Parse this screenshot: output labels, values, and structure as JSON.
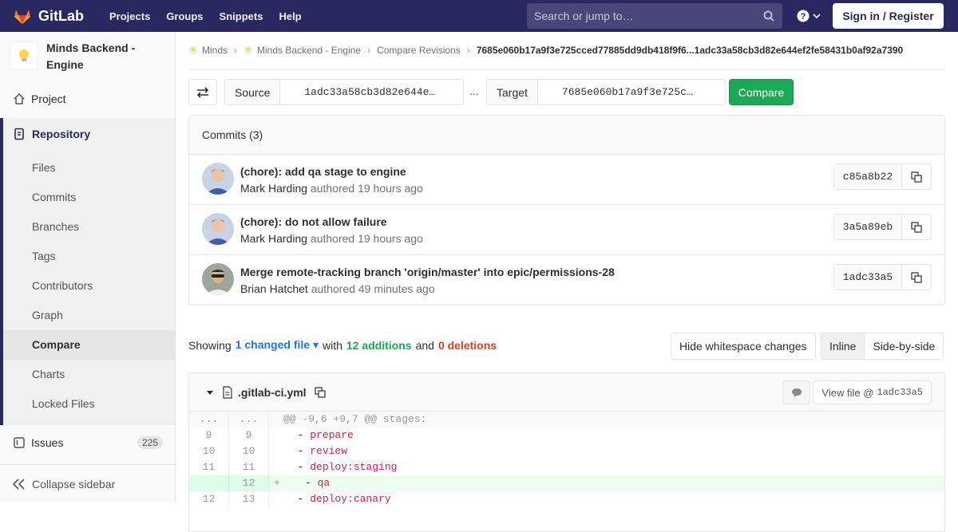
{
  "navbar": {
    "brand": "GitLab",
    "links": [
      "Projects",
      "Groups",
      "Snippets",
      "Help"
    ],
    "search_placeholder": "Search or jump to…",
    "signin_label": "Sign in / Register"
  },
  "sidebar": {
    "project_name": "Minds Backend - Engine",
    "project_link": "Project",
    "repository_label": "Repository",
    "repo_items": [
      "Files",
      "Commits",
      "Branches",
      "Tags",
      "Contributors",
      "Graph",
      "Compare",
      "Charts",
      "Locked Files"
    ],
    "active_item": "Compare",
    "issues_label": "Issues",
    "issues_count": "225",
    "collapse_label": "Collapse sidebar"
  },
  "breadcrumbs": [
    "Minds",
    "Minds Backend - Engine",
    "Compare Revisions",
    "7685e060b17a9f3e725cced77885dd9db418f9f6...1adc33a58cb3d82e644ef2fe58431b0af92a7390"
  ],
  "compare": {
    "source_label": "Source",
    "source_value": "1adc33a58cb3d82e644e…",
    "dots": "...",
    "target_label": "Target",
    "target_value": "7685e060b17a9f3e725c…",
    "compare_button": "Compare"
  },
  "commits": {
    "header": "Commits (3)",
    "items": [
      {
        "title": "(chore): add qa stage to engine",
        "author": "Mark Harding",
        "verb": "authored",
        "time": "19 hours ago",
        "sha": "c85a8b22"
      },
      {
        "title": "(chore): do not allow failure",
        "author": "Mark Harding",
        "verb": "authored",
        "time": "19 hours ago",
        "sha": "3a5a89eb"
      },
      {
        "title": "Merge remote-tracking branch 'origin/master' into epic/permissions-28",
        "author": "Brian Hatchet",
        "verb": "authored",
        "time": "49 minutes ago",
        "sha": "1adc33a5"
      }
    ]
  },
  "summary": {
    "showing": "Showing",
    "changed_files": "1 changed file",
    "with": "with",
    "additions": "12 additions",
    "and": "and",
    "deletions": "0 deletions"
  },
  "diff_controls": {
    "whitespace_button": "Hide whitespace changes",
    "inline_label": "Inline",
    "side_by_side_label": "Side-by-side"
  },
  "file": {
    "name": ".gitlab-ci.yml",
    "view_file_label": "View file @",
    "view_file_sha": "1adc33a5",
    "lines": [
      {
        "old": "...",
        "new": "...",
        "type": "hunk",
        "sign": "",
        "text": "@@ -9,6 +9,7 @@ stages:"
      },
      {
        "old": "9",
        "new": "9",
        "type": "ctx",
        "sign": "",
        "text": "prepare"
      },
      {
        "old": "10",
        "new": "10",
        "type": "ctx",
        "sign": "",
        "text": "review"
      },
      {
        "old": "11",
        "new": "11",
        "type": "ctx",
        "sign": "",
        "text": "deploy:staging"
      },
      {
        "old": "",
        "new": "12",
        "type": "add",
        "sign": "+",
        "text": "qa"
      },
      {
        "old": "12",
        "new": "13",
        "type": "ctx",
        "sign": "",
        "text": "deploy:canary"
      }
    ]
  },
  "colors": {
    "navbar": "#292961",
    "accent_green": "#1aaa55",
    "link_blue": "#1f78d1",
    "deletion_red": "#db3b21"
  }
}
